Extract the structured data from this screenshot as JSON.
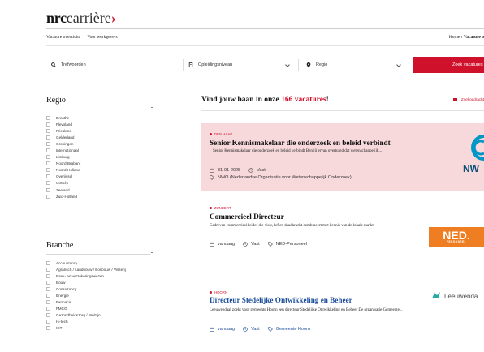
{
  "brand": {
    "name_bold": "nrc",
    "name_light": "carrière",
    "arrow": "›",
    "accent_color": "#d0112b"
  },
  "topnav": {
    "items": [
      "Vacature overzicht",
      "Voor werkgevers"
    ],
    "breadcrumb_home": "Home",
    "breadcrumb_sep": "›",
    "breadcrumb_current": "Vacature o"
  },
  "search": {
    "keyword_placeholder": "Trefwoorden",
    "keyword_icon": "search-icon",
    "level_label": "Opleidingsniveau",
    "level_icon": "graduation-icon",
    "region_label": "Regio",
    "region_icon": "location-pin-icon",
    "button_label": "Zoek vacatures"
  },
  "filters": {
    "regio": {
      "title": "Regio",
      "items": [
        "Drenthe",
        "Flevoland",
        "Friesland",
        "Gelderland",
        "Groningen",
        "Internationaal",
        "Limburg",
        "Noord-Brabant",
        "Noord-Holland",
        "Overijssel",
        "Utrecht",
        "Zeeland",
        "Zuid-Holland"
      ]
    },
    "branche": {
      "title": "Branche",
      "items": [
        "Accountancy",
        "Agrarisch / Landbouw / Bosbouw / Visserij",
        "Bank- en verzekeringswezen",
        "Bouw",
        "Consultancy",
        "Energie",
        "Farmacie",
        "FMCG",
        "Gezondheidszorg / Welzijn",
        "Hi-tech",
        "ICT"
      ]
    }
  },
  "main": {
    "heading_prefix": "Vind jouw baan in onze",
    "heading_count": "166 vacatures",
    "heading_suffix": "!",
    "alert_label": "Zoekopdracht"
  },
  "jobs": [
    {
      "location": "DEN HAAG",
      "title": "Senior Kennismakelaar die onderzoek en beleid verbindt",
      "description": "Senior Kennismakelaar die onderzoek en beleid verbindt Ben jij ervan overtuigd dat wetenschappelijk...",
      "date": "31-01-2025",
      "type": "Vast",
      "employer": "NWO (Nederlandse Organisatie voor Wetenschappelijk Onderzoek)",
      "logo_text": "NW"
    },
    {
      "location": "ZUNDERT",
      "title": "Commercieel Directeur",
      "description": "Gedreven commercieel leider die visie, lef en daadkracht combineert met kennis van de lokale markt.",
      "date": "vandaag",
      "type": "Vast",
      "employer": "NED-Personeel",
      "logo_text": "NED.",
      "logo_sub": "PERSONEEL"
    },
    {
      "location": "HOORN",
      "title": "Directeur Stedelijke Ontwikkeling en Beheer",
      "description": "Leeuwendaal zoekt voor gemeente Hoorn een directeur Stedelijke Ontwikkeling en Beheer De organisatie Gemeente...",
      "date": "vandaag",
      "type": "Vast",
      "employer": "Gemeente Hoorn",
      "logo_text": "Leeuwenda"
    }
  ]
}
